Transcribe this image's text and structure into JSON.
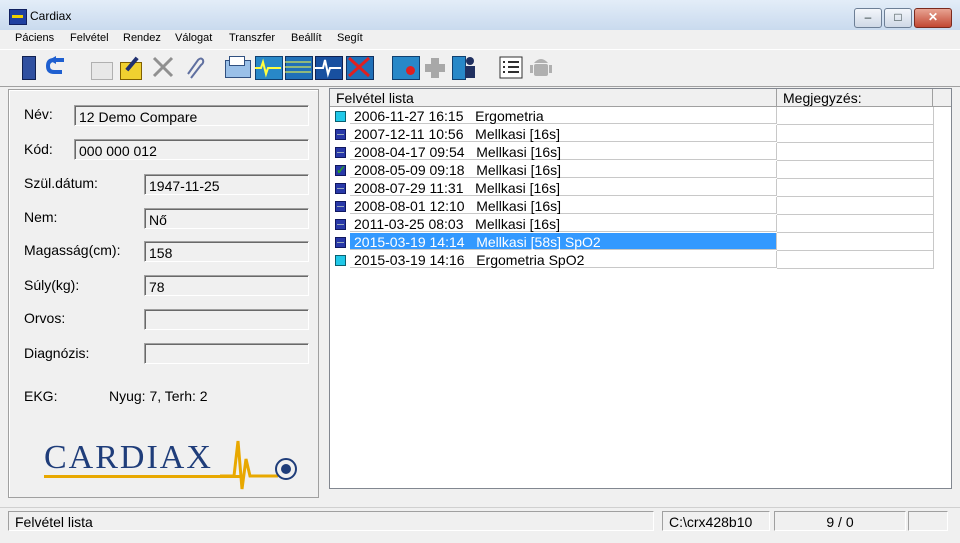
{
  "window": {
    "title": "Cardiax"
  },
  "menu": [
    "Páciens",
    "Felvétel",
    "Rendez",
    "Válogat",
    "Transzfer",
    "Beállít",
    "Segít"
  ],
  "toolbar": {
    "icons": [
      "exit-door-icon",
      "back-arrow-icon",
      "new-document-icon",
      "edit-document-icon",
      "delete-tools-icon",
      "attach-paperclip-icon",
      "print-icon",
      "ecg-grid-icon",
      "ecg-multi-icon",
      "ecg-monitor-icon",
      "ecg-delete-icon",
      "record-icon",
      "add-cross-icon",
      "patient-figure-icon",
      "list-icon",
      "android-icon"
    ]
  },
  "patient": {
    "name_label": "Név:",
    "name_value": "12 Demo Compare",
    "code_label": "Kód:",
    "code_value": "000 000 012",
    "dob_label": "Szül.dátum:",
    "dob_value": "1947-11-25",
    "sex_label": "Nem:",
    "sex_value": "Nő",
    "height_label": "Magasság(cm):",
    "height_value": "158",
    "weight_label": "Súly(kg):",
    "weight_value": "78",
    "doctor_label": "Orvos:",
    "doctor_value": "",
    "diagnosis_label": "Diagnózis:",
    "diagnosis_value": "",
    "ekg_label": "EKG:",
    "ekg_value": "Nyug: 7, Terh: 2",
    "logo_text": "CARDIAX"
  },
  "recordings": {
    "col1": "Felvétel lista",
    "col2": "Megjegyzés:",
    "rows": [
      {
        "text": "2006-11-27 16:15   Ergometria",
        "icon": "folder",
        "note": ""
      },
      {
        "text": "2007-12-11 10:56   Mellkasi [16s]",
        "icon": "ecg",
        "note": ""
      },
      {
        "text": "2008-04-17 09:54   Mellkasi [16s]",
        "icon": "ecg",
        "note": ""
      },
      {
        "text": "2008-05-09 09:18   Mellkasi [16s]",
        "icon": "checked",
        "note": ""
      },
      {
        "text": "2008-07-29 11:31   Mellkasi [16s]",
        "icon": "ecg",
        "note": ""
      },
      {
        "text": "2008-08-01 12:10   Mellkasi [16s]",
        "icon": "ecg",
        "note": ""
      },
      {
        "text": "2011-03-25 08:03   Mellkasi [16s]",
        "icon": "ecg",
        "note": ""
      },
      {
        "text": "2015-03-19 14:14   Mellkasi [58s] SpO2",
        "icon": "ecg",
        "note": "",
        "selected": true
      },
      {
        "text": "2015-03-19 14:16   Ergometria SpO2",
        "icon": "folder",
        "note": ""
      }
    ]
  },
  "status": {
    "left": "Felvétel lista",
    "path": "C:\\crx428b10",
    "count": "9 / 0"
  }
}
